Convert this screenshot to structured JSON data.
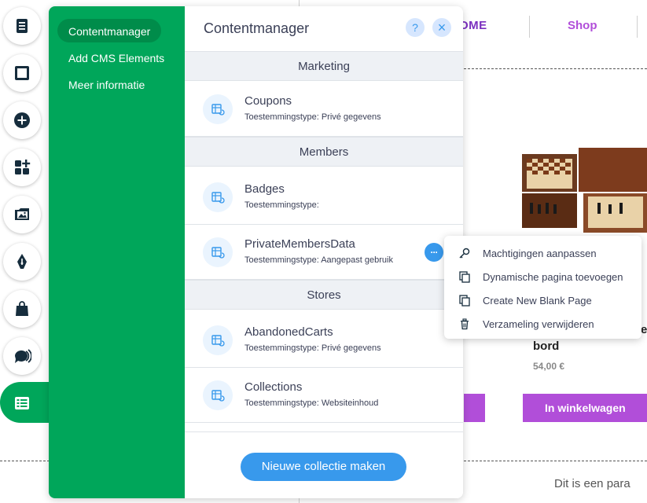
{
  "site": {
    "nav_home": "OME",
    "nav_shop": "Shop",
    "product_title": "bord",
    "product_price": "54,00 €",
    "partial_text": "e",
    "cart_button": "In winkelwagen",
    "paragraph": "Dit is een para"
  },
  "toolbar": {
    "items": [
      "pages-icon",
      "background-icon",
      "add-icon",
      "apps-icon",
      "media-icon",
      "pen-icon",
      "store-icon",
      "chat-icon",
      "cms-icon"
    ]
  },
  "panel": {
    "nav": [
      {
        "label": "Contentmanager",
        "selected": true
      },
      {
        "label": "Add CMS Elements",
        "selected": false
      },
      {
        "label": "Meer informatie",
        "selected": false
      }
    ],
    "title": "Contentmanager",
    "help_label": "?",
    "close_label": "×",
    "sections": [
      {
        "name": "Marketing",
        "collections": [
          {
            "name": "Coupons",
            "permission": "Toestemmingstype: Privé gegevens"
          }
        ]
      },
      {
        "name": "Members",
        "collections": [
          {
            "name": "Badges",
            "permission": "Toestemmingstype:"
          },
          {
            "name": "PrivateMembersData",
            "permission": "Toestemmingstype: Aangepast gebruik"
          }
        ]
      },
      {
        "name": "Stores",
        "collections": [
          {
            "name": "AbandonedCarts",
            "permission": "Toestemmingstype: Privé gegevens"
          },
          {
            "name": "Collections",
            "permission": "Toestemmingstype: Websiteinhoud"
          }
        ]
      }
    ],
    "more_label": "···",
    "new_collection_button": "Nieuwe collectie maken"
  },
  "context_menu": {
    "items": [
      {
        "label": "Machtigingen aanpassen",
        "icon": "key-icon"
      },
      {
        "label": "Dynamische pagina toevoegen",
        "icon": "copy-page-icon"
      },
      {
        "label": "Create New Blank Page",
        "icon": "blank-page-icon"
      },
      {
        "label": "Verzameling verwijderen",
        "icon": "trash-icon"
      }
    ]
  },
  "colors": {
    "accent_green": "#00a65a",
    "accent_blue": "#3899ec",
    "site_purple": "#b14ed9"
  }
}
